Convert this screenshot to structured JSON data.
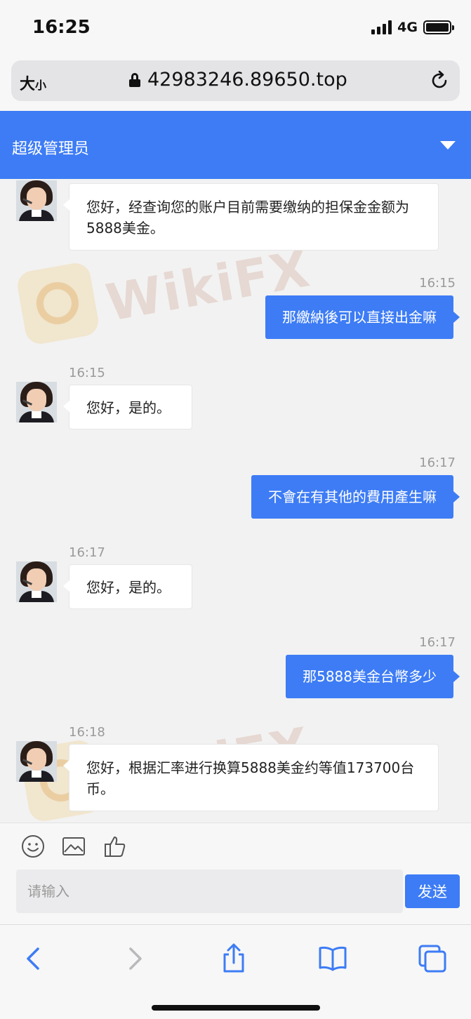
{
  "status_bar": {
    "time": "16:25",
    "network": "4G"
  },
  "browser": {
    "text_size_label": "大",
    "text_size_small": "小",
    "url": "42983246.89650.top"
  },
  "header": {
    "title": "超级管理员"
  },
  "watermark": {
    "text": "WikiFX"
  },
  "messages": [
    {
      "side": "left",
      "time": "",
      "text": "您好，经查询您的账户目前需要缴纳的担保金金额为5888美金。"
    },
    {
      "side": "right",
      "time": "16:15",
      "text": "那繳納後可以直接出金嘛"
    },
    {
      "side": "left",
      "time": "16:15",
      "text": "您好，是的。"
    },
    {
      "side": "right",
      "time": "16:17",
      "text": "不會在有其他的費用產生嘛"
    },
    {
      "side": "left",
      "time": "16:17",
      "text": "您好，是的。"
    },
    {
      "side": "right",
      "time": "16:17",
      "text": "那5888美金台幣多少"
    },
    {
      "side": "left",
      "time": "16:18",
      "text": "您好，根据汇率进行换算5888美金约等值173700台币。"
    }
  ],
  "composer": {
    "placeholder": "请输入",
    "send_label": "发送",
    "tools": [
      "emoji-icon",
      "image-icon",
      "thumbs-up-icon"
    ]
  },
  "browser_nav": [
    "back-icon",
    "forward-icon",
    "share-icon",
    "bookmarks-icon",
    "tabs-icon"
  ],
  "colors": {
    "accent": "#3d7cf5",
    "background": "#f2f2f2"
  }
}
